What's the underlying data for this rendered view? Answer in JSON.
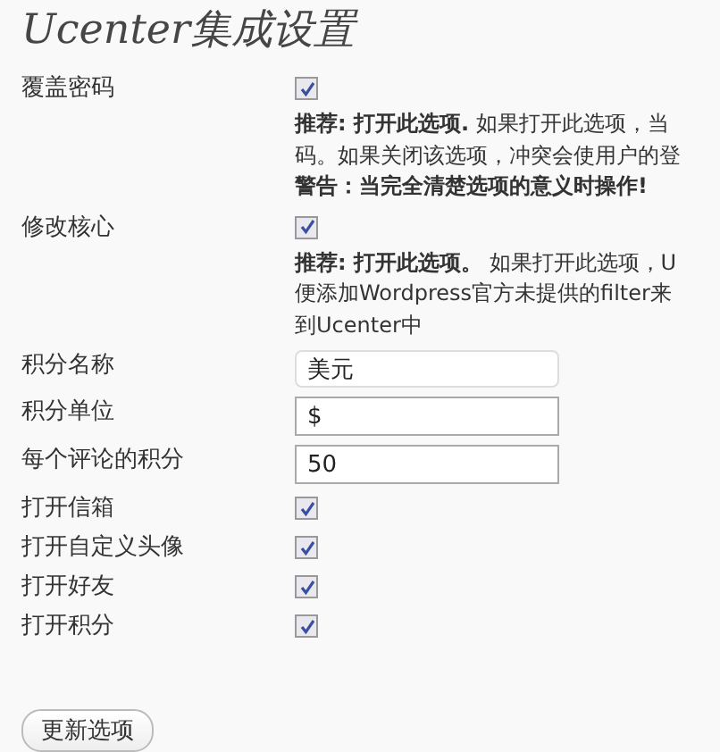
{
  "title": "Ucenter集成设置",
  "rows": [
    {
      "kind": "checkbox",
      "label": "覆盖密码",
      "checked": true,
      "description": [
        "**推荐: 打开此选项.** 如果打开此选项，当",
        "码。如果关闭该选项，冲突会使用户的登",
        "**警告：当完全清楚选项的意义时操作!**"
      ]
    },
    {
      "kind": "checkbox",
      "label": "修改核心",
      "checked": true,
      "description": [
        "**推荐: 打开此选项。** 如果打开此选项，U",
        "便添加Wordpress官方未提供的filter来",
        "到Ucenter中"
      ]
    },
    {
      "kind": "text_field",
      "label": "积分名称",
      "value": "美元"
    },
    {
      "kind": "text_field",
      "label": "积分单位",
      "value": "$"
    },
    {
      "kind": "text_field",
      "label": "每个评论的积分",
      "value": "50"
    },
    {
      "kind": "checkbox",
      "label": "打开信箱",
      "checked": true
    },
    {
      "kind": "checkbox",
      "label": "打开自定义头像",
      "checked": true
    },
    {
      "kind": "checkbox",
      "label": "打开好友",
      "checked": true
    },
    {
      "kind": "checkbox",
      "label": "打开积分",
      "checked": true
    }
  ],
  "button": "更新选项"
}
